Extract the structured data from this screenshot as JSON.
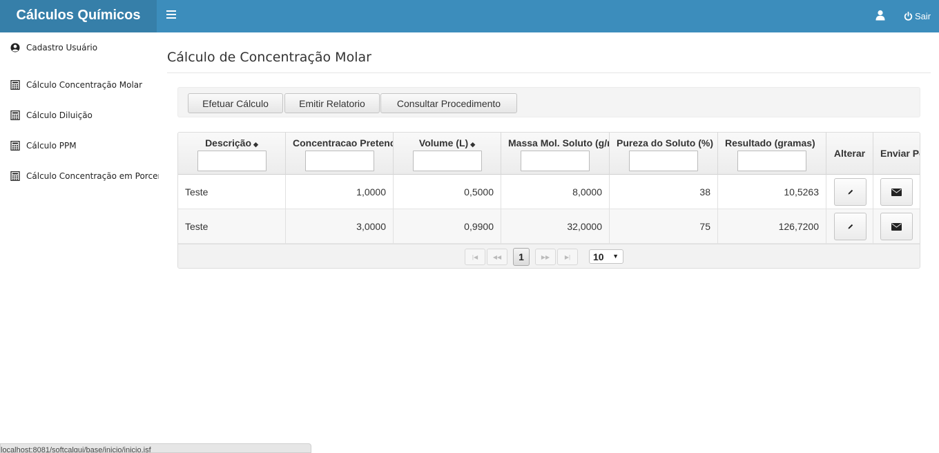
{
  "app": {
    "title": "Cálculos Químicos",
    "logout_label": "Sair"
  },
  "icons": {
    "menu": "hamburger-icon",
    "user": "user-icon",
    "power": "power-icon",
    "calculator": "calculator-icon",
    "user_circle": "user-circle-icon",
    "edit": "pencil-icon",
    "send": "envelope-icon"
  },
  "colors": {
    "header": "#3c8dbc",
    "brand": "#367fa9"
  },
  "sidebar": {
    "items": [
      {
        "label": "Cadastro Usuário",
        "icon": "user-circle-icon"
      },
      {
        "label": "Cálculo Concentração Molar",
        "icon": "calculator-icon"
      },
      {
        "label": "Cálculo Diluição",
        "icon": "calculator-icon"
      },
      {
        "label": "Cálculo PPM",
        "icon": "calculator-icon"
      },
      {
        "label": "Cálculo Concentração em Porcentagem",
        "icon": "calculator-icon"
      }
    ]
  },
  "page": {
    "title": "Cálculo de Concentração Molar"
  },
  "toolbar": {
    "calc_label": "Efetuar Cálculo",
    "report_label": "Emitir Relatorio",
    "procedure_label": "Consultar Procedimento"
  },
  "table": {
    "columns": [
      {
        "label": "Descrição",
        "sortable": true
      },
      {
        "label": "Concentracao Pretendida",
        "sortable": false
      },
      {
        "label": "Volume (L)",
        "sortable": true
      },
      {
        "label": "Massa Mol. Soluto (g/mol)",
        "sortable": false
      },
      {
        "label": "Pureza do Soluto (%)",
        "sortable": false
      },
      {
        "label": "Resultado (gramas)",
        "sortable": false
      },
      {
        "label": "Alterar",
        "sortable": false
      },
      {
        "label": "Enviar Por Email",
        "sortable": false
      }
    ],
    "rows": [
      {
        "descricao": "Teste",
        "concentracao": "1,0000",
        "volume": "0,5000",
        "massa": "8,0000",
        "pureza": "38",
        "resultado": "10,5263"
      },
      {
        "descricao": "Teste",
        "concentracao": "3,0000",
        "volume": "0,9900",
        "massa": "32,0000",
        "pureza": "75",
        "resultado": "126,7200"
      }
    ]
  },
  "pager": {
    "first": "|◀",
    "prev": "◀◀",
    "current_page": "1",
    "next": "▶▶",
    "last": "▶|",
    "rows_per_page": "10"
  },
  "status_bar": {
    "url": "localhost:8081/softcalqui/base/inicio/inicio.jsf"
  }
}
